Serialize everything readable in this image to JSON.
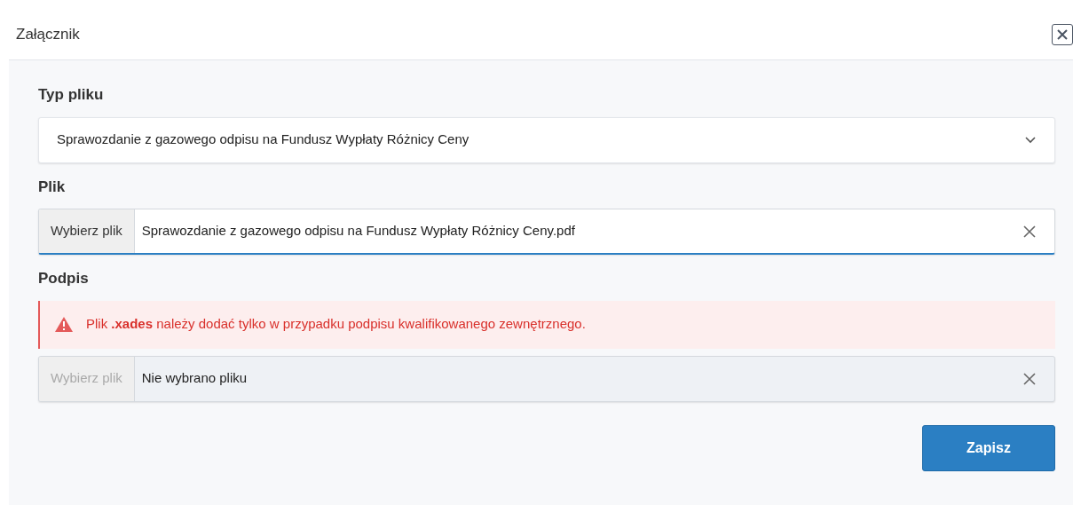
{
  "dialog": {
    "title": "Załącznik"
  },
  "fields": [
    {
      "kind": "select",
      "label": "Typ pliku",
      "value": "Sprawozdanie z gazowego odpisu na Fundusz Wypłaty Różnicy Ceny"
    },
    {
      "kind": "file",
      "label": "Plik",
      "button": "Wybierz plik",
      "value": "Sprawozdanie z gazowego odpisu na Fundusz Wypłaty Różnicy Ceny.pdf",
      "disabled": false,
      "focused": true
    },
    {
      "kind": "file",
      "label": "Podpis",
      "alert": "Plik **.xades** należy dodać tylko w przypadku podpisu kwalifikowanego zewnętrznego.",
      "button": "Wybierz plik",
      "value": "Nie wybrano pliku",
      "disabled": true,
      "focused": false
    }
  ],
  "save_button": "Zapisz"
}
